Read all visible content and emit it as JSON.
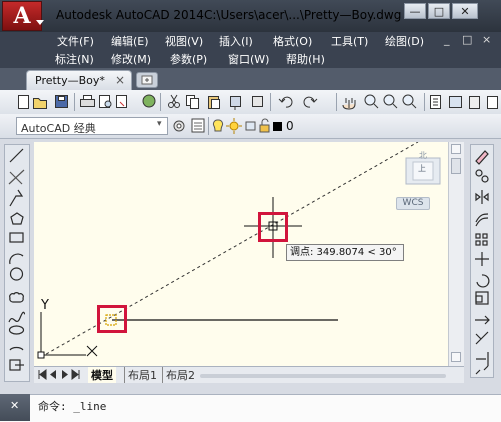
{
  "window": {
    "app_logo_letter": "A",
    "app_title": "Autodesk AutoCAD 2014",
    "doc_path": "C:\\Users\\acer\\...\\Pretty—Boy.dwg",
    "btn_minimize": "—",
    "btn_restore": "□",
    "btn_close": "✕"
  },
  "menu": {
    "row1": [
      "文件(F)",
      "编辑(E)",
      "视图(V)",
      "插入(I)",
      "格式(O)",
      "工具(T)",
      "绘图(D)"
    ],
    "row2": [
      "标注(N)",
      "修改(M)",
      "参数(P)",
      "窗口(W)",
      "帮助(H)"
    ],
    "doc_controls": [
      "_",
      "□",
      "×"
    ]
  },
  "doc_tab": {
    "label": "Pretty—Boy*",
    "close": "×"
  },
  "workspace": {
    "value": "AutoCAD 经典"
  },
  "layer": {
    "value": "0"
  },
  "viewcube": {
    "wcs_label": "WCS",
    "top_label": "上",
    "top_north": "北"
  },
  "tooltip": {
    "text": "调点: 349.8074 < 30°"
  },
  "ucs": {
    "y_label": "Y",
    "x_label": "X"
  },
  "layout_tabs": [
    "模型",
    "布局1",
    "布局2"
  ],
  "command": {
    "text": "命令: _line",
    "close_glyph": "✕"
  },
  "colors": {
    "titlebar": "#2c333d",
    "canvas": "#fffded",
    "highlight": "#d1143c",
    "menu_bg": "#3a4250"
  }
}
